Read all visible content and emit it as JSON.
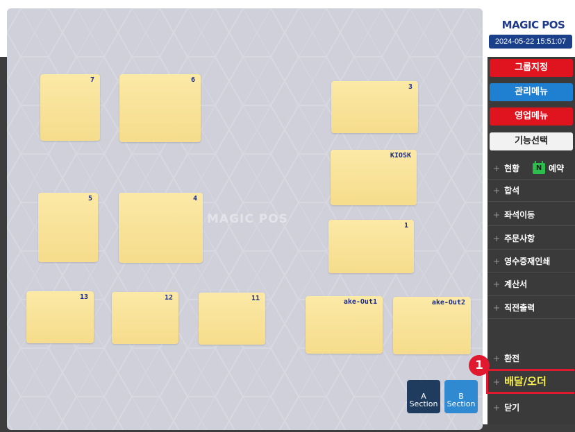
{
  "app": {
    "brand": "MAGIC POS",
    "datetime": "2024-05-22 15:51:07",
    "watermark": "MAGIC POS"
  },
  "tables": [
    {
      "label": "7"
    },
    {
      "label": "6"
    },
    {
      "label": "3"
    },
    {
      "label": "KIOSK"
    },
    {
      "label": "5"
    },
    {
      "label": "4"
    },
    {
      "label": "1"
    },
    {
      "label": "13"
    },
    {
      "label": "12"
    },
    {
      "label": "11"
    },
    {
      "label": "ake-Out1"
    },
    {
      "label": "ake-Out2"
    }
  ],
  "sections": [
    {
      "line1": "A",
      "line2": "Section",
      "color": "#1f3c5e"
    },
    {
      "line1": "B",
      "line2": "Section",
      "color": "#2f8ad1"
    }
  ],
  "sidebar": {
    "buttons": [
      {
        "label": "그룹지정",
        "color": "#e0141e"
      },
      {
        "label": "관리메뉴",
        "color": "#1f7fd0"
      },
      {
        "label": "영업메뉴",
        "color": "#e0141e"
      },
      {
        "label": "기능선택",
        "color": "#f2f2f2"
      }
    ],
    "menu": [
      {
        "label": "현황"
      },
      {
        "label": "합석"
      },
      {
        "label": "좌석이동"
      },
      {
        "label": "주문사항"
      },
      {
        "label": "영수증재인쇄"
      },
      {
        "label": "계산서"
      },
      {
        "label": "직전출력"
      },
      {
        "label": "환전"
      },
      {
        "label": "배달/오더"
      },
      {
        "label": "닫기"
      }
    ],
    "reservation": {
      "icon_text": "N",
      "label": "예약"
    }
  },
  "annotation": {
    "marker": "1",
    "color": "#e0192f"
  }
}
